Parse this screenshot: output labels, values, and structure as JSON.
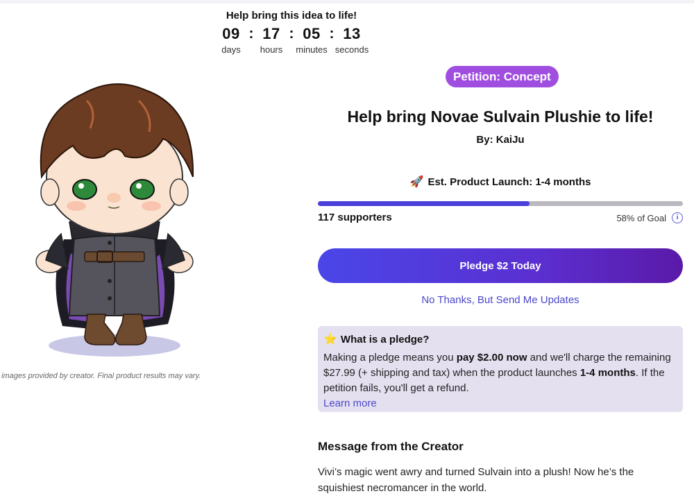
{
  "countdown": {
    "title": "Help bring this idea to life!",
    "units": [
      {
        "value": "09",
        "label": "days"
      },
      {
        "value": "17",
        "label": "hours"
      },
      {
        "value": "05",
        "label": "minutes"
      },
      {
        "value": "13",
        "label": "seconds"
      }
    ],
    "separator": ":"
  },
  "image": {
    "caption": "images provided by creator. Final product results may vary."
  },
  "badge": "Petition: Concept",
  "product": {
    "title": "Help bring Novae Sulvain Plushie to life!",
    "byline": "By: KaiJu",
    "launch_icon": "rocket-icon",
    "launch": "Est. Product Launch: 1-4 months"
  },
  "progress": {
    "fraction": 0.58,
    "supporters": "117 supporters",
    "goal": "58% of Goal"
  },
  "cta": {
    "pledge": "Pledge $2 Today",
    "no_thanks": "No Thanks, But Send Me Updates"
  },
  "pledge_info": {
    "icon": "star-icon",
    "heading": "What is a pledge?",
    "t1": "Making a pledge means you ",
    "b1": "pay $2.00 now",
    "t2": " and we'll charge the remaining $27.99 (+ shipping and tax) when the product launches ",
    "b2": "1-4 months",
    "t3": ". If the petition fails, you'll get a refund.",
    "learn_more": "Learn more"
  },
  "message": {
    "heading": "Message from the Creator",
    "body": "Vivi’s magic went awry and turned Sulvain into a plush! Now he’s the squishiest necromancer in the world."
  },
  "colors": {
    "accent": "#4a47c9",
    "badge": "#a04ee0",
    "progress_fill": "#4a3fd9",
    "pledge_box_bg": "#e5e0f0"
  }
}
